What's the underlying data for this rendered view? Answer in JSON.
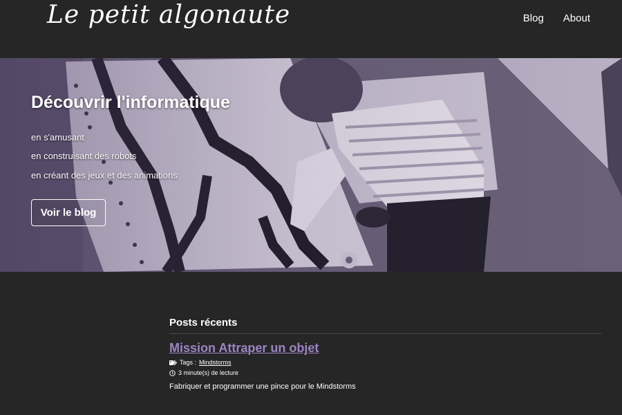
{
  "header": {
    "logo": "Le petit algonaute",
    "nav": [
      {
        "label": "Blog"
      },
      {
        "label": "About"
      }
    ]
  },
  "hero": {
    "title": "Découvrir l'informatique",
    "lines": [
      "en s'amusant",
      "en construisant des robots",
      "en créant des jeux et des animations"
    ],
    "button_label": "Voir le blog"
  },
  "posts": {
    "heading": "Posts récents",
    "items": [
      {
        "title": "Mission Attraper un objet",
        "tags_label": "Tags :",
        "tag": "Mindstorms",
        "reading_time": "3 minute(s) de lecture",
        "excerpt": "Fabriquer et programmer une pince pour le Mindstorms"
      }
    ]
  },
  "colors": {
    "background": "#262626",
    "accent_link": "#9d84c4",
    "hero_tint": "#6f6682"
  }
}
